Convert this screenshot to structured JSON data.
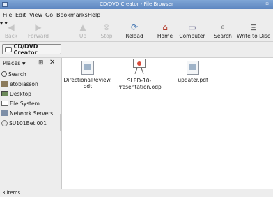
{
  "window": {
    "title": "CD/DVD Creator - File Browser"
  },
  "menu": {
    "file": "File",
    "edit": "Edit",
    "view": "View",
    "go": "Go",
    "bookmarks": "Bookmarks",
    "help": "Help"
  },
  "toolbar": {
    "back": "Back",
    "forward": "Forward",
    "up": "Up",
    "stop": "Stop",
    "reload": "Reload",
    "home": "Home",
    "computer": "Computer",
    "search": "Search",
    "write": "Write to Disc"
  },
  "location": {
    "crumb": "CD/DVD Creator"
  },
  "sidebar": {
    "header": "Places",
    "items": [
      {
        "label": "Search",
        "icon": "search-icon"
      },
      {
        "label": "etobiasson",
        "icon": "home-folder-icon"
      },
      {
        "label": "Desktop",
        "icon": "desktop-icon"
      },
      {
        "label": "File System",
        "icon": "file-system-icon"
      },
      {
        "label": "Network Servers",
        "icon": "network-icon"
      },
      {
        "label": "SU101Bet.001",
        "icon": "cd-icon"
      }
    ]
  },
  "files": [
    {
      "line1": "DirectionalReview.",
      "line2": "odt",
      "icon": "document-icon"
    },
    {
      "line1": "SLED-10-",
      "line2": "Presentation.odp",
      "icon": "presentation-icon"
    },
    {
      "line1": "updater.pdf",
      "line2": "",
      "icon": "pdf-icon"
    }
  ],
  "status": {
    "text": "3 items"
  },
  "colors": {
    "titlebar": "#5d86c0",
    "window_bg": "#ededed",
    "content_bg": "#ffffff"
  }
}
